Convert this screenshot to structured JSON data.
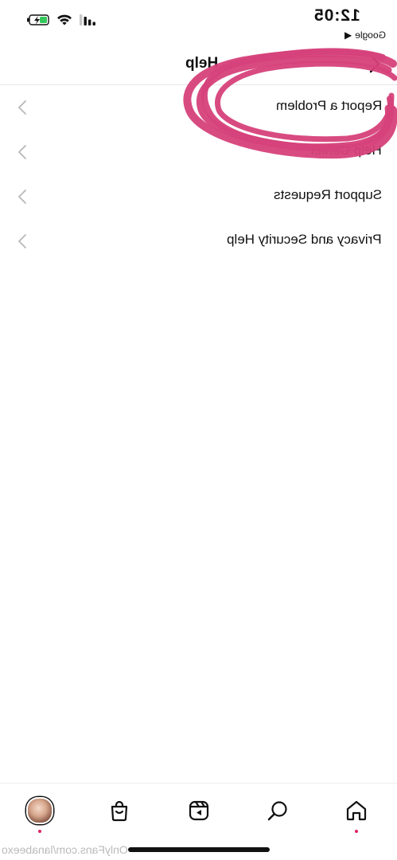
{
  "status_bar": {
    "time": "12:05",
    "back_app": "Google",
    "back_arrow": "◀",
    "icons": [
      "battery-charging-icon",
      "wifi-icon",
      "cellular-signal-icon"
    ]
  },
  "header": {
    "title": "Help",
    "back_icon": "chevron-left-icon"
  },
  "menu": {
    "items": [
      {
        "label": "Report a Problem"
      },
      {
        "label": "Help Center"
      },
      {
        "label": "Support Requests"
      },
      {
        "label": "Privacy and Security Help"
      }
    ]
  },
  "annotation": {
    "type": "scribble-circle",
    "color": "#d6417a"
  },
  "tab_bar": {
    "tabs": [
      "home-icon",
      "search-icon",
      "reels-icon",
      "shop-icon",
      "profile-avatar"
    ],
    "notification_dot_color": "#e0245e"
  },
  "watermark": {
    "text": "OnlyFans.com/lanabeexo"
  },
  "colors": {
    "accent": "#d6417a",
    "text": "#111111",
    "divider": "#e6e6e6"
  }
}
